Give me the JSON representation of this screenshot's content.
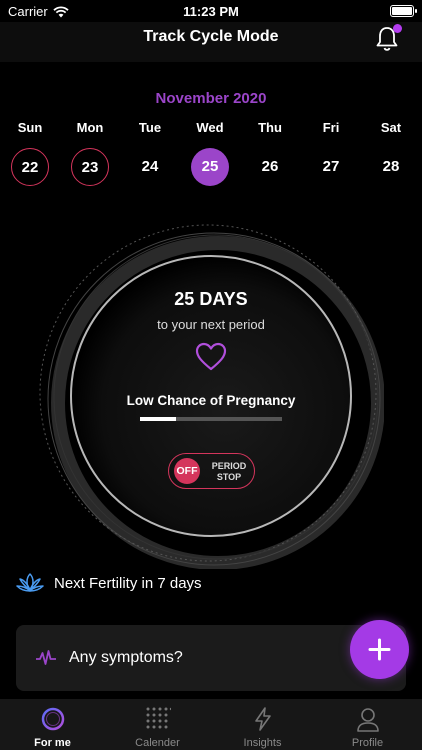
{
  "status_bar": {
    "carrier": "Carrier",
    "time": "11:23 PM"
  },
  "header": {
    "title": "Track Cycle Mode",
    "notification_icon": "bell-icon"
  },
  "calendar": {
    "month": "November 2020",
    "days": [
      {
        "name": "Sun",
        "num": "22",
        "state": "period"
      },
      {
        "name": "Mon",
        "num": "23",
        "state": "period"
      },
      {
        "name": "Tue",
        "num": "24",
        "state": "normal"
      },
      {
        "name": "Wed",
        "num": "25",
        "state": "today"
      },
      {
        "name": "Thu",
        "num": "26",
        "state": "normal"
      },
      {
        "name": "Fri",
        "num": "27",
        "state": "normal"
      },
      {
        "name": "Sat",
        "num": "28",
        "state": "normal"
      }
    ]
  },
  "cycle": {
    "days_count": "25 DAYS",
    "days_subtitle": "to your next period",
    "pregnancy_chance": "Low Chance of Pregnancy",
    "pregnancy_progress": 0.25,
    "toggle_state": "OFF",
    "toggle_label_1": "PERIOD",
    "toggle_label_2": "STOP"
  },
  "fertility": {
    "text": "Next Fertility in 7 days",
    "icon": "lotus-icon"
  },
  "symptoms": {
    "text": "Any symptoms?",
    "icon": "pulse-icon"
  },
  "fab": {
    "icon": "plus-icon"
  },
  "tabs": [
    {
      "label": "For me",
      "icon": "circle-icon",
      "active": true
    },
    {
      "label": "Calender",
      "icon": "calendar-dots-icon",
      "active": false
    },
    {
      "label": "Insights",
      "icon": "lightning-icon",
      "active": false
    },
    {
      "label": "Profile",
      "icon": "user-icon",
      "active": false
    }
  ],
  "colors": {
    "accent": "#9b45c9",
    "period": "#d4355c",
    "fab": "#a43ae6",
    "fertility": "#4a9bf0"
  }
}
